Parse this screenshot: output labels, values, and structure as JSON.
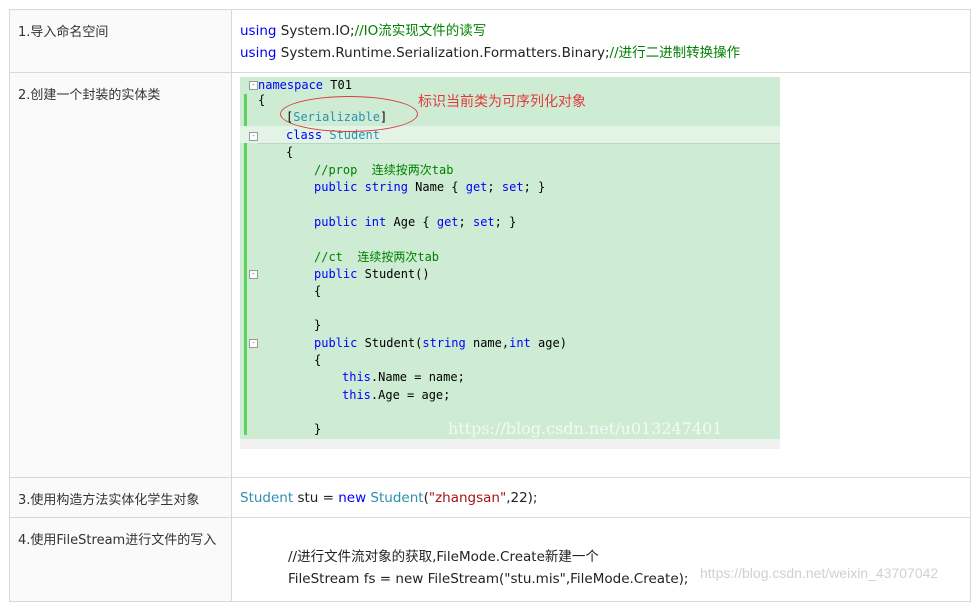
{
  "rows": [
    {
      "label": "1.导入命名空间",
      "lines": [
        {
          "kw": "using",
          "rest": " System.IO;",
          "comment": "//IO流实现文件的读写"
        },
        {
          "kw": "using",
          "rest": " System.Runtime.Serialization.Formatters.Binary;",
          "comment": "//进行二进制转换操作"
        }
      ]
    },
    {
      "label": "2.创建一个封装的实体类",
      "code": {
        "annotation": "标识当前类为可序列化对象",
        "watermark": "https://blog.csdn.net/u013247401",
        "l01_kw": "namespace",
        "l01_rest": " T01",
        "l02": "{",
        "l03_open": "[",
        "l03_attr": "Serializable",
        "l03_close": "]",
        "l04_kw": "class",
        "l04_cls": " Student",
        "l05": "{",
        "l06": "//prop  连续按两次tab",
        "l07_kw1": "public",
        "l07_kw2": " string",
        "l07_mid": " Name { ",
        "l07_kw3": "get",
        "l07_sep": "; ",
        "l07_kw4": "set",
        "l07_end": "; }",
        "l08_kw1": "public",
        "l08_kw2": " int",
        "l08_mid": " Age { ",
        "l08_kw3": "get",
        "l08_sep": "; ",
        "l08_kw4": "set",
        "l08_end": "; }",
        "l09": "//ct  连续按两次tab",
        "l10_kw": "public",
        "l10_rest": " Student()",
        "l11": "{",
        "l12": "}",
        "l13_kw": "public",
        "l13_mid": " Student(",
        "l13_kw2": "string",
        "l13_mid2": " name,",
        "l13_kw3": "int",
        "l13_end": " age)",
        "l14": "{",
        "l15_kw": "this",
        "l15_rest": ".Name = name;",
        "l16_kw": "this",
        "l16_rest": ".Age = age;",
        "l17": "}"
      }
    },
    {
      "label": "3.使用构造方法实体化学生对象",
      "cls1": "Student",
      "mid1": " stu = ",
      "kw": "new",
      "cls2": " Student",
      "open": "(",
      "str": "\"zhangsan\"",
      "end": ",22);"
    },
    {
      "label": "4.使用FileStream进行文件的写入",
      "line1": "//进行文件流对象的获取,FileMode.Create新建一个",
      "line2": "FileStream fs = new FileStream(\"stu.mis\",FileMode.Create);"
    }
  ],
  "page_watermark": "https://blog.csdn.net/weixin_43707042"
}
